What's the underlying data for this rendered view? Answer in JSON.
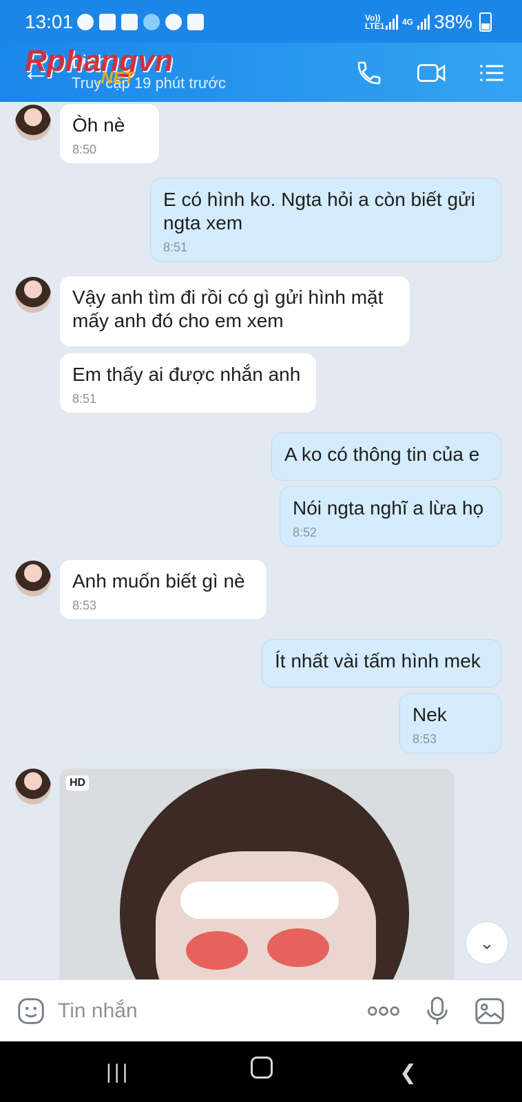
{
  "status_bar": {
    "time": "13:01",
    "network_label": "Vo)) LTE1",
    "network_4g": "4G",
    "battery": "38%"
  },
  "header": {
    "contact_name": "Linh",
    "presence": "Truy cập 19 phút trước"
  },
  "watermark": {
    "main": "Rphangvn",
    "suffix": ".NET"
  },
  "messages": [
    {
      "side": "in",
      "text": "Òh nè",
      "time": "8:50"
    },
    {
      "side": "out",
      "text": "E có hình ko. Ngta hỏi a còn biết gửi ngta xem",
      "time": "8:51"
    },
    {
      "side": "in",
      "text": "Vậy anh tìm đi rồi có gì gửi hình mặt mấy anh đó cho em xem",
      "time": ""
    },
    {
      "side": "in",
      "text": "Em thấy ai được nhắn anh",
      "time": "8:51"
    },
    {
      "side": "out",
      "text": "A ko có thông tin của e",
      "time": ""
    },
    {
      "side": "out",
      "text": "Nói ngta nghĩ a lừa họ",
      "time": "8:52"
    },
    {
      "side": "in",
      "text": "Anh muốn biết gì nè",
      "time": "8:53"
    },
    {
      "side": "out",
      "text": "Ít nhất vài tấm hình mek",
      "time": ""
    },
    {
      "side": "out",
      "text": "Nek",
      "time": "8:53"
    }
  ],
  "photo": {
    "badge": "HD"
  },
  "input": {
    "placeholder": "Tin nhắn"
  },
  "icons": [
    "back-arrow-icon",
    "phone-icon",
    "video-call-icon",
    "menu-list-icon",
    "sticker-icon",
    "more-icon",
    "mic-icon",
    "image-icon",
    "chevron-down-icon"
  ]
}
